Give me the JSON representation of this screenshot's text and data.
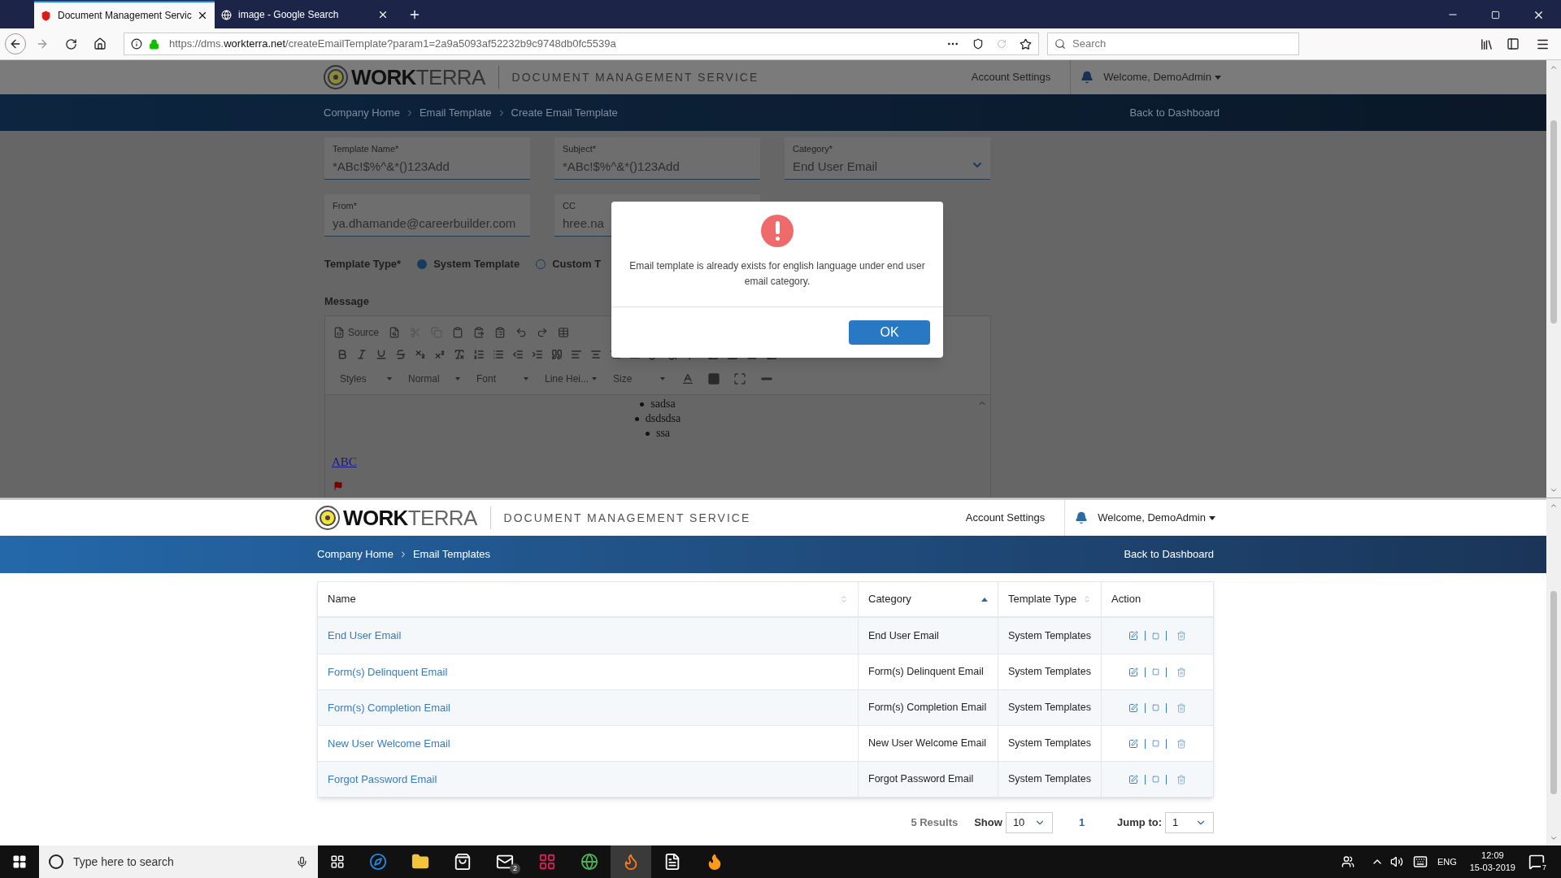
{
  "browser": {
    "tabs": [
      {
        "title": "Document Management Servic",
        "selected": true
      },
      {
        "title": "image - Google Search",
        "selected": false
      }
    ],
    "url": {
      "prefix": "https://dms.",
      "domain": "workterra.net",
      "path": "/createEmailTemplate?param1=2a9a5093af52232b9c9748db0fc5539a"
    },
    "search_placeholder": "Search"
  },
  "top_page": {
    "header": {
      "brand_bold": "WORK",
      "brand_light": "TERRA",
      "service": "DOCUMENT MANAGEMENT SERVICE",
      "account_settings": "Account Settings",
      "welcome": "Welcome, DemoAdmin"
    },
    "breadcrumbs": [
      "Company Home",
      "Email Template",
      "Create Email Template"
    ],
    "back": "Back to Dashboard",
    "fields": [
      {
        "label": "Template Name*",
        "value": "*ABc!$%^&*()123Add",
        "kind": "text"
      },
      {
        "label": "Subject*",
        "value": "*ABc!$%^&*()123Add",
        "kind": "text"
      },
      {
        "label": "Category*",
        "value": "End User Email",
        "kind": "select"
      },
      {
        "label": "From*",
        "value": "ya.dhamande@careerbuilder.com",
        "kind": "text"
      },
      {
        "label": "CC",
        "value": "hree.na",
        "kind": "text"
      }
    ],
    "template_type": {
      "label": "Template Type*",
      "options": [
        {
          "label": "System Template",
          "selected": true
        },
        {
          "label": "Custom T",
          "selected": false
        }
      ]
    },
    "message_label": "Message",
    "editor": {
      "source": "Source",
      "dropdowns": [
        "Styles",
        "Normal",
        "Font",
        "Line Hei...",
        "Size"
      ],
      "bullets": [
        "sadsa",
        "dsdsdsa",
        "ssa"
      ],
      "link": "ABC"
    }
  },
  "dialog": {
    "message": "Email template is already exists for english language under end user email category.",
    "button": "OK"
  },
  "bottom_page": {
    "header": {
      "brand_bold": "WORK",
      "brand_light": "TERRA",
      "service": "DOCUMENT MANAGEMENT SERVICE",
      "account_settings": "Account Settings",
      "welcome": "Welcome, DemoAdmin"
    },
    "breadcrumbs": [
      "Company Home",
      "Email Templates"
    ],
    "back": "Back to Dashboard",
    "table": {
      "columns": [
        {
          "label": "Name",
          "sortable": true,
          "sorted": false
        },
        {
          "label": "Category",
          "sortable": true,
          "sorted": true
        },
        {
          "label": "Template Type",
          "sortable": true,
          "sorted": false
        },
        {
          "label": "Action"
        }
      ],
      "rows": [
        {
          "name": "End User Email",
          "category": "End User Email",
          "type": "System Templates"
        },
        {
          "name": "Form(s) Delinquent Email",
          "category": "Form(s) Delinquent Email",
          "type": "System Templates"
        },
        {
          "name": "Form(s) Completion Email",
          "category": "Form(s) Completion Email",
          "type": "System Templates"
        },
        {
          "name": "New User Welcome Email",
          "category": "New User Welcome Email",
          "type": "System Templates"
        },
        {
          "name": "Forgot Password Email",
          "category": "Forgot Password Email",
          "type": "System Templates"
        }
      ]
    },
    "pagination": {
      "results": "5 Results",
      "show_label": "Show",
      "show_value": "10",
      "page": "1",
      "jump_label": "Jump to:",
      "jump_value": "1"
    }
  },
  "taskbar": {
    "search_placeholder": "Type here to search",
    "mail_badge": "2",
    "language": "ENG",
    "time": "12:09",
    "date": "15-03-2019",
    "notifications": "7"
  }
}
